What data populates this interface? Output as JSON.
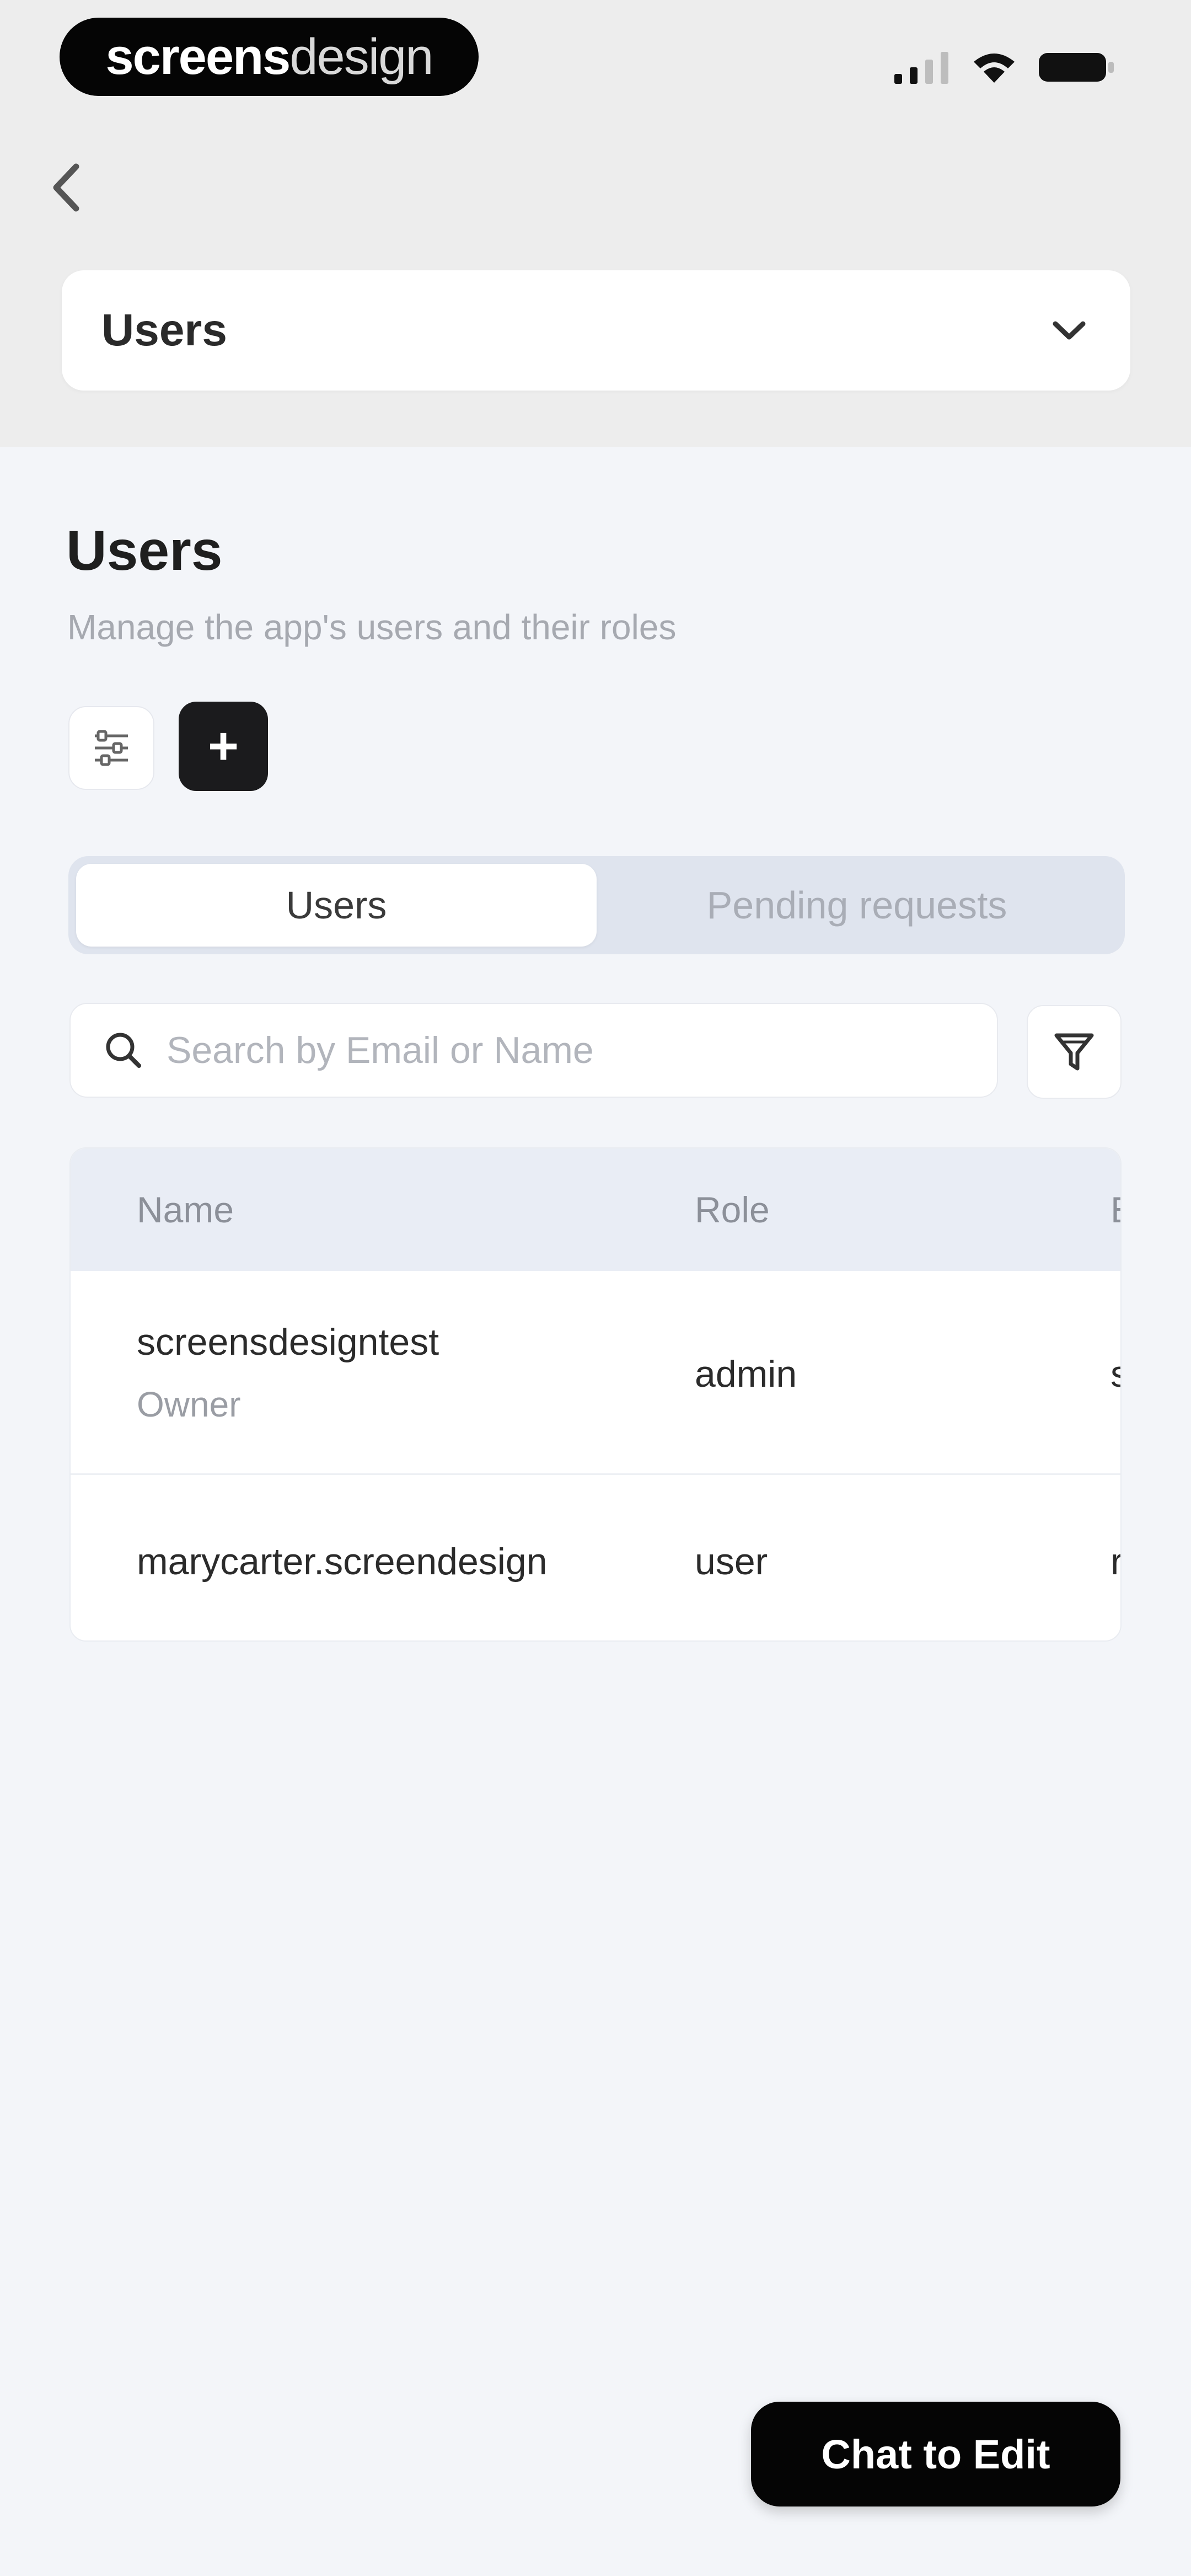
{
  "status_bar": {
    "brand_bold": "screens",
    "brand_light": "design",
    "icons": [
      "signal-icon",
      "wifi-icon",
      "battery-icon"
    ]
  },
  "header": {
    "back_icon": "chevron-left-icon",
    "selector_label": "Users",
    "selector_icon": "chevron-down-icon"
  },
  "page": {
    "title": "Users",
    "subtitle": "Manage the app's users and their roles",
    "settings_icon": "sliders-icon",
    "add_label": "+"
  },
  "tabs": [
    {
      "label": "Users",
      "active": true
    },
    {
      "label": "Pending requests",
      "active": false
    }
  ],
  "search": {
    "placeholder": "Search by Email or Name",
    "value": "",
    "icon": "search-icon",
    "filter_icon": "filter-icon"
  },
  "table": {
    "columns": [
      "Name",
      "Role",
      "E"
    ],
    "rows": [
      {
        "name": "screensdesigntest",
        "sub": "Owner",
        "role": "admin",
        "extra": "s"
      },
      {
        "name": "marycarter.screendesign",
        "sub": "",
        "role": "user",
        "extra": "r"
      }
    ]
  },
  "chat_button": {
    "label": "Chat to Edit"
  },
  "colors": {
    "header_bg": "#ededed",
    "page_bg": "#f3f5f9",
    "dark": "#050505",
    "tab_track": "#dfe4ee"
  }
}
